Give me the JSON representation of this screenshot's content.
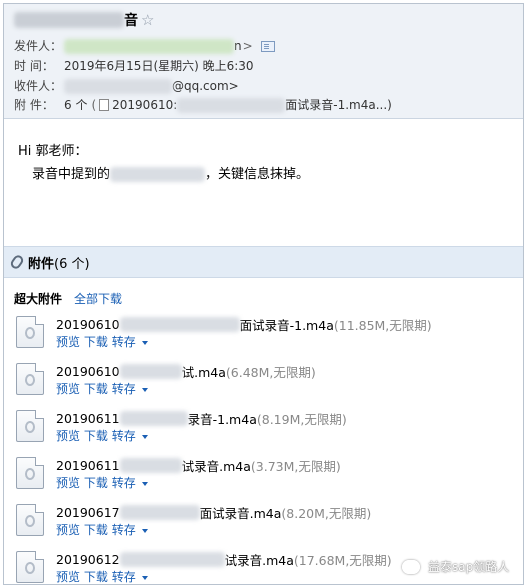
{
  "header": {
    "subject_suffix": "音",
    "star": "☆",
    "from_label": "发件人：",
    "from_tail": "n",
    "from_gt": ">",
    "time_label": "时 间：",
    "time_value": "2019年6月15日(星期六) 晚上6:30",
    "to_label": "收件人：",
    "to_tail": "@qq.com>",
    "att_label": "附 件：",
    "att_count": "6 个",
    "att_open_paren": "(",
    "att_first_prefix": "20190610:",
    "att_first_suffix": "面试录音-1.m4a",
    "att_close": "...)"
  },
  "body": {
    "greeting": "Hi 郭老师：",
    "line_prefix": "录音中提到的",
    "line_suffix": "，关键信息抹掉。"
  },
  "attachments_bar": {
    "title": "附件",
    "count": "(6 个)"
  },
  "big_attachments": {
    "title": "超大附件",
    "download_all": "全部下载"
  },
  "actions": {
    "preview": "预览",
    "download": "下载",
    "save": "转存"
  },
  "attachments": [
    {
      "prefix": "20190610",
      "suffix": "面试录音-1.m4a",
      "meta": "(11.85M,无限期)"
    },
    {
      "prefix": "20190610",
      "suffix": "试.m4a",
      "meta": "(6.48M,无限期)"
    },
    {
      "prefix": "20190611",
      "suffix": "录音-1.m4a",
      "meta": "(8.19M,无限期)"
    },
    {
      "prefix": "20190611",
      "suffix": "试录音.m4a",
      "meta": "(3.73M,无限期)"
    },
    {
      "prefix": "20190617",
      "suffix": "面试录音.m4a",
      "meta": "(8.20M,无限期)"
    },
    {
      "prefix": "20190612",
      "suffix": "试录音.m4a",
      "meta": "(17.68M,无限期)"
    }
  ],
  "watermark": {
    "text": "益泰sap领路人"
  },
  "colors": {
    "header_bg": "#eef2f7",
    "attachment_bar_bg": "#e3ecf6",
    "link": "#1a5fb4"
  }
}
